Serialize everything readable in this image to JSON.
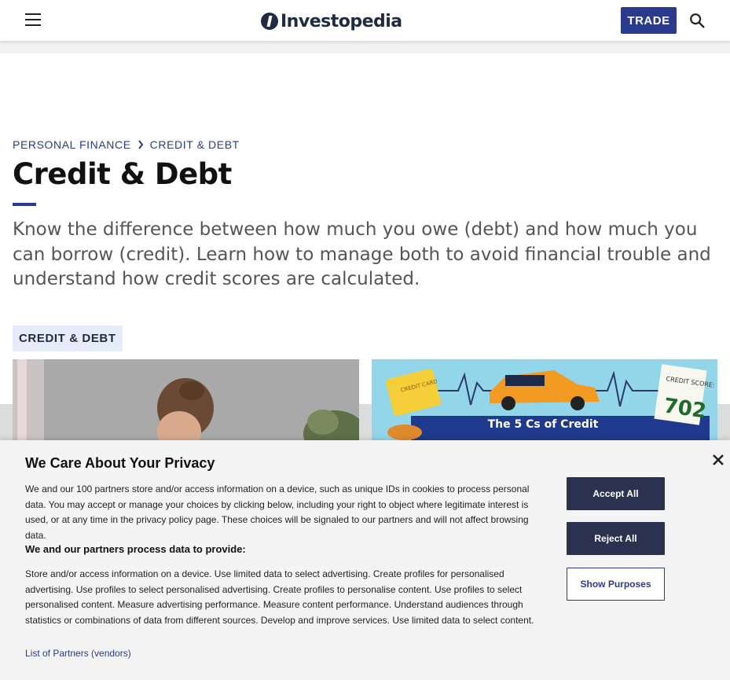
{
  "header": {
    "logo_text": "Investopedia",
    "trade_label": "TRADE"
  },
  "breadcrumb": {
    "items": [
      "PERSONAL FINANCE",
      "CREDIT & DEBT"
    ]
  },
  "page": {
    "title": "Credit & Debt",
    "intro": "Know the difference between how much you owe (debt) and how much you can borrow (credit). Learn how to manage both to avoid financial trouble and understand how credit scores are calculated.",
    "tag": "CREDIT & DEBT"
  },
  "cards": {
    "card2_banner": "The 5 Cs of Credit",
    "card2_credit_card_text": "CREDIT CARD",
    "card2_score_label": "CREDIT SCORE:",
    "card2_score_value": "702"
  },
  "privacy": {
    "title": "We Care About Your Privacy",
    "body": "We and our 100 partners store and/or access information on a device, such as unique IDs in cookies to process personal data. You may accept or manage your choices by clicking below, including your right to object where legitimate interest is used, or at any time in the privacy policy page. These choices will be signaled to our partners and will not affect browsing data.",
    "subheading": "We and our partners process data to provide:",
    "purposes": "Store and/or access information on a device. Use limited data to select advertising. Create profiles for personalised advertising. Use profiles to select personalised advertising. Create profiles to personalise content. Use profiles to select personalised content. Measure advertising performance. Measure content performance. Understand audiences through statistics or combinations of data from different sources. Develop and improve services. Use limited data to select content.",
    "partners_link": "List of Partners (vendors)",
    "accept_label": "Accept All",
    "reject_label": "Reject All",
    "purposes_label": "Show Purposes"
  },
  "colors": {
    "brand_navy": "#2b3a8c",
    "button_dark": "#2b3250",
    "tag_bg": "#e6ecfa"
  }
}
